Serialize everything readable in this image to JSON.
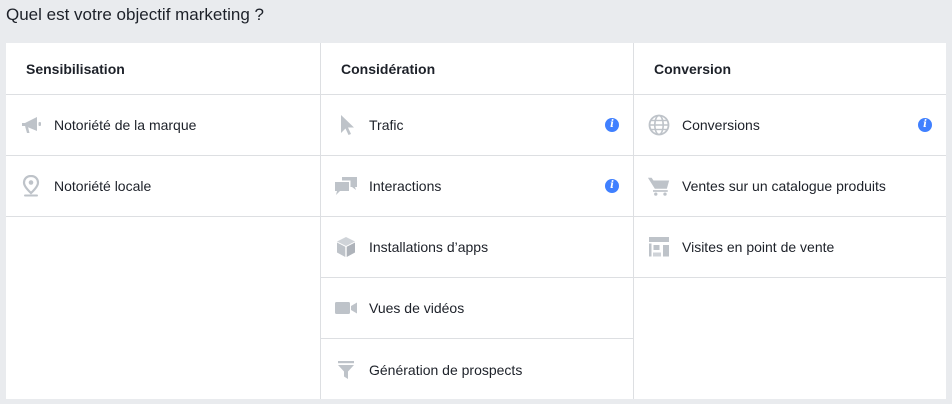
{
  "heading": "Quel est votre objectif marketing ?",
  "columns": [
    {
      "title": "Sensibilisation",
      "items": [
        {
          "label": "Notoriété de la marque",
          "icon": "megaphone-icon"
        },
        {
          "label": "Notoriété locale",
          "icon": "map-pin-icon"
        }
      ]
    },
    {
      "title": "Considération",
      "items": [
        {
          "label": "Trafic",
          "icon": "cursor-icon",
          "info": "i"
        },
        {
          "label": "Interactions",
          "icon": "chat-bubbles-icon",
          "info": "i"
        },
        {
          "label": "Installations d’apps",
          "icon": "box-icon"
        },
        {
          "label": "Vues de vidéos",
          "icon": "video-camera-icon"
        },
        {
          "label": "Génération de prospects",
          "icon": "funnel-icon"
        }
      ]
    },
    {
      "title": "Conversion",
      "items": [
        {
          "label": "Conversions",
          "icon": "globe-icon",
          "info": "i"
        },
        {
          "label": "Ventes sur un catalogue produits",
          "icon": "shopping-cart-icon"
        },
        {
          "label": "Visites en point de vente",
          "icon": "storefront-icon"
        }
      ]
    }
  ],
  "colors": {
    "background": "#e9ebee",
    "panel": "#ffffff",
    "divider": "#dddfe2",
    "icon": "#bec3c9",
    "info": "#4080ff",
    "text": "#1d2129"
  }
}
